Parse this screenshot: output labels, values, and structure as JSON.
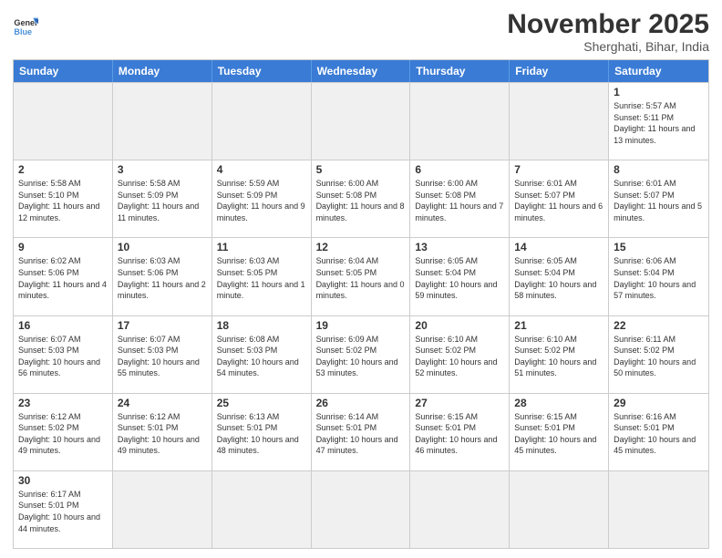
{
  "header": {
    "logo_general": "General",
    "logo_blue": "Blue",
    "month_title": "November 2025",
    "location": "Sherghati, Bihar, India"
  },
  "weekdays": [
    "Sunday",
    "Monday",
    "Tuesday",
    "Wednesday",
    "Thursday",
    "Friday",
    "Saturday"
  ],
  "rows": [
    [
      {
        "day": "",
        "empty": true
      },
      {
        "day": "",
        "empty": true
      },
      {
        "day": "",
        "empty": true
      },
      {
        "day": "",
        "empty": true
      },
      {
        "day": "",
        "empty": true
      },
      {
        "day": "",
        "empty": true
      },
      {
        "day": "1",
        "sunrise": "5:57 AM",
        "sunset": "5:11 PM",
        "daylight": "11 hours and 13 minutes."
      }
    ],
    [
      {
        "day": "2",
        "sunrise": "5:58 AM",
        "sunset": "5:10 PM",
        "daylight": "11 hours and 12 minutes."
      },
      {
        "day": "3",
        "sunrise": "5:58 AM",
        "sunset": "5:09 PM",
        "daylight": "11 hours and 11 minutes."
      },
      {
        "day": "4",
        "sunrise": "5:59 AM",
        "sunset": "5:09 PM",
        "daylight": "11 hours and 9 minutes."
      },
      {
        "day": "5",
        "sunrise": "6:00 AM",
        "sunset": "5:08 PM",
        "daylight": "11 hours and 8 minutes."
      },
      {
        "day": "6",
        "sunrise": "6:00 AM",
        "sunset": "5:08 PM",
        "daylight": "11 hours and 7 minutes."
      },
      {
        "day": "7",
        "sunrise": "6:01 AM",
        "sunset": "5:07 PM",
        "daylight": "11 hours and 6 minutes."
      },
      {
        "day": "8",
        "sunrise": "6:01 AM",
        "sunset": "5:07 PM",
        "daylight": "11 hours and 5 minutes."
      }
    ],
    [
      {
        "day": "9",
        "sunrise": "6:02 AM",
        "sunset": "5:06 PM",
        "daylight": "11 hours and 4 minutes."
      },
      {
        "day": "10",
        "sunrise": "6:03 AM",
        "sunset": "5:06 PM",
        "daylight": "11 hours and 2 minutes."
      },
      {
        "day": "11",
        "sunrise": "6:03 AM",
        "sunset": "5:05 PM",
        "daylight": "11 hours and 1 minute."
      },
      {
        "day": "12",
        "sunrise": "6:04 AM",
        "sunset": "5:05 PM",
        "daylight": "11 hours and 0 minutes."
      },
      {
        "day": "13",
        "sunrise": "6:05 AM",
        "sunset": "5:04 PM",
        "daylight": "10 hours and 59 minutes."
      },
      {
        "day": "14",
        "sunrise": "6:05 AM",
        "sunset": "5:04 PM",
        "daylight": "10 hours and 58 minutes."
      },
      {
        "day": "15",
        "sunrise": "6:06 AM",
        "sunset": "5:04 PM",
        "daylight": "10 hours and 57 minutes."
      }
    ],
    [
      {
        "day": "16",
        "sunrise": "6:07 AM",
        "sunset": "5:03 PM",
        "daylight": "10 hours and 56 minutes."
      },
      {
        "day": "17",
        "sunrise": "6:07 AM",
        "sunset": "5:03 PM",
        "daylight": "10 hours and 55 minutes."
      },
      {
        "day": "18",
        "sunrise": "6:08 AM",
        "sunset": "5:03 PM",
        "daylight": "10 hours and 54 minutes."
      },
      {
        "day": "19",
        "sunrise": "6:09 AM",
        "sunset": "5:02 PM",
        "daylight": "10 hours and 53 minutes."
      },
      {
        "day": "20",
        "sunrise": "6:10 AM",
        "sunset": "5:02 PM",
        "daylight": "10 hours and 52 minutes."
      },
      {
        "day": "21",
        "sunrise": "6:10 AM",
        "sunset": "5:02 PM",
        "daylight": "10 hours and 51 minutes."
      },
      {
        "day": "22",
        "sunrise": "6:11 AM",
        "sunset": "5:02 PM",
        "daylight": "10 hours and 50 minutes."
      }
    ],
    [
      {
        "day": "23",
        "sunrise": "6:12 AM",
        "sunset": "5:02 PM",
        "daylight": "10 hours and 49 minutes."
      },
      {
        "day": "24",
        "sunrise": "6:12 AM",
        "sunset": "5:01 PM",
        "daylight": "10 hours and 49 minutes."
      },
      {
        "day": "25",
        "sunrise": "6:13 AM",
        "sunset": "5:01 PM",
        "daylight": "10 hours and 48 minutes."
      },
      {
        "day": "26",
        "sunrise": "6:14 AM",
        "sunset": "5:01 PM",
        "daylight": "10 hours and 47 minutes."
      },
      {
        "day": "27",
        "sunrise": "6:15 AM",
        "sunset": "5:01 PM",
        "daylight": "10 hours and 46 minutes."
      },
      {
        "day": "28",
        "sunrise": "6:15 AM",
        "sunset": "5:01 PM",
        "daylight": "10 hours and 45 minutes."
      },
      {
        "day": "29",
        "sunrise": "6:16 AM",
        "sunset": "5:01 PM",
        "daylight": "10 hours and 45 minutes."
      }
    ],
    [
      {
        "day": "30",
        "sunrise": "6:17 AM",
        "sunset": "5:01 PM",
        "daylight": "10 hours and 44 minutes."
      },
      {
        "day": "",
        "empty": true
      },
      {
        "day": "",
        "empty": true
      },
      {
        "day": "",
        "empty": true
      },
      {
        "day": "",
        "empty": true
      },
      {
        "day": "",
        "empty": true
      },
      {
        "day": "",
        "empty": true
      }
    ]
  ]
}
